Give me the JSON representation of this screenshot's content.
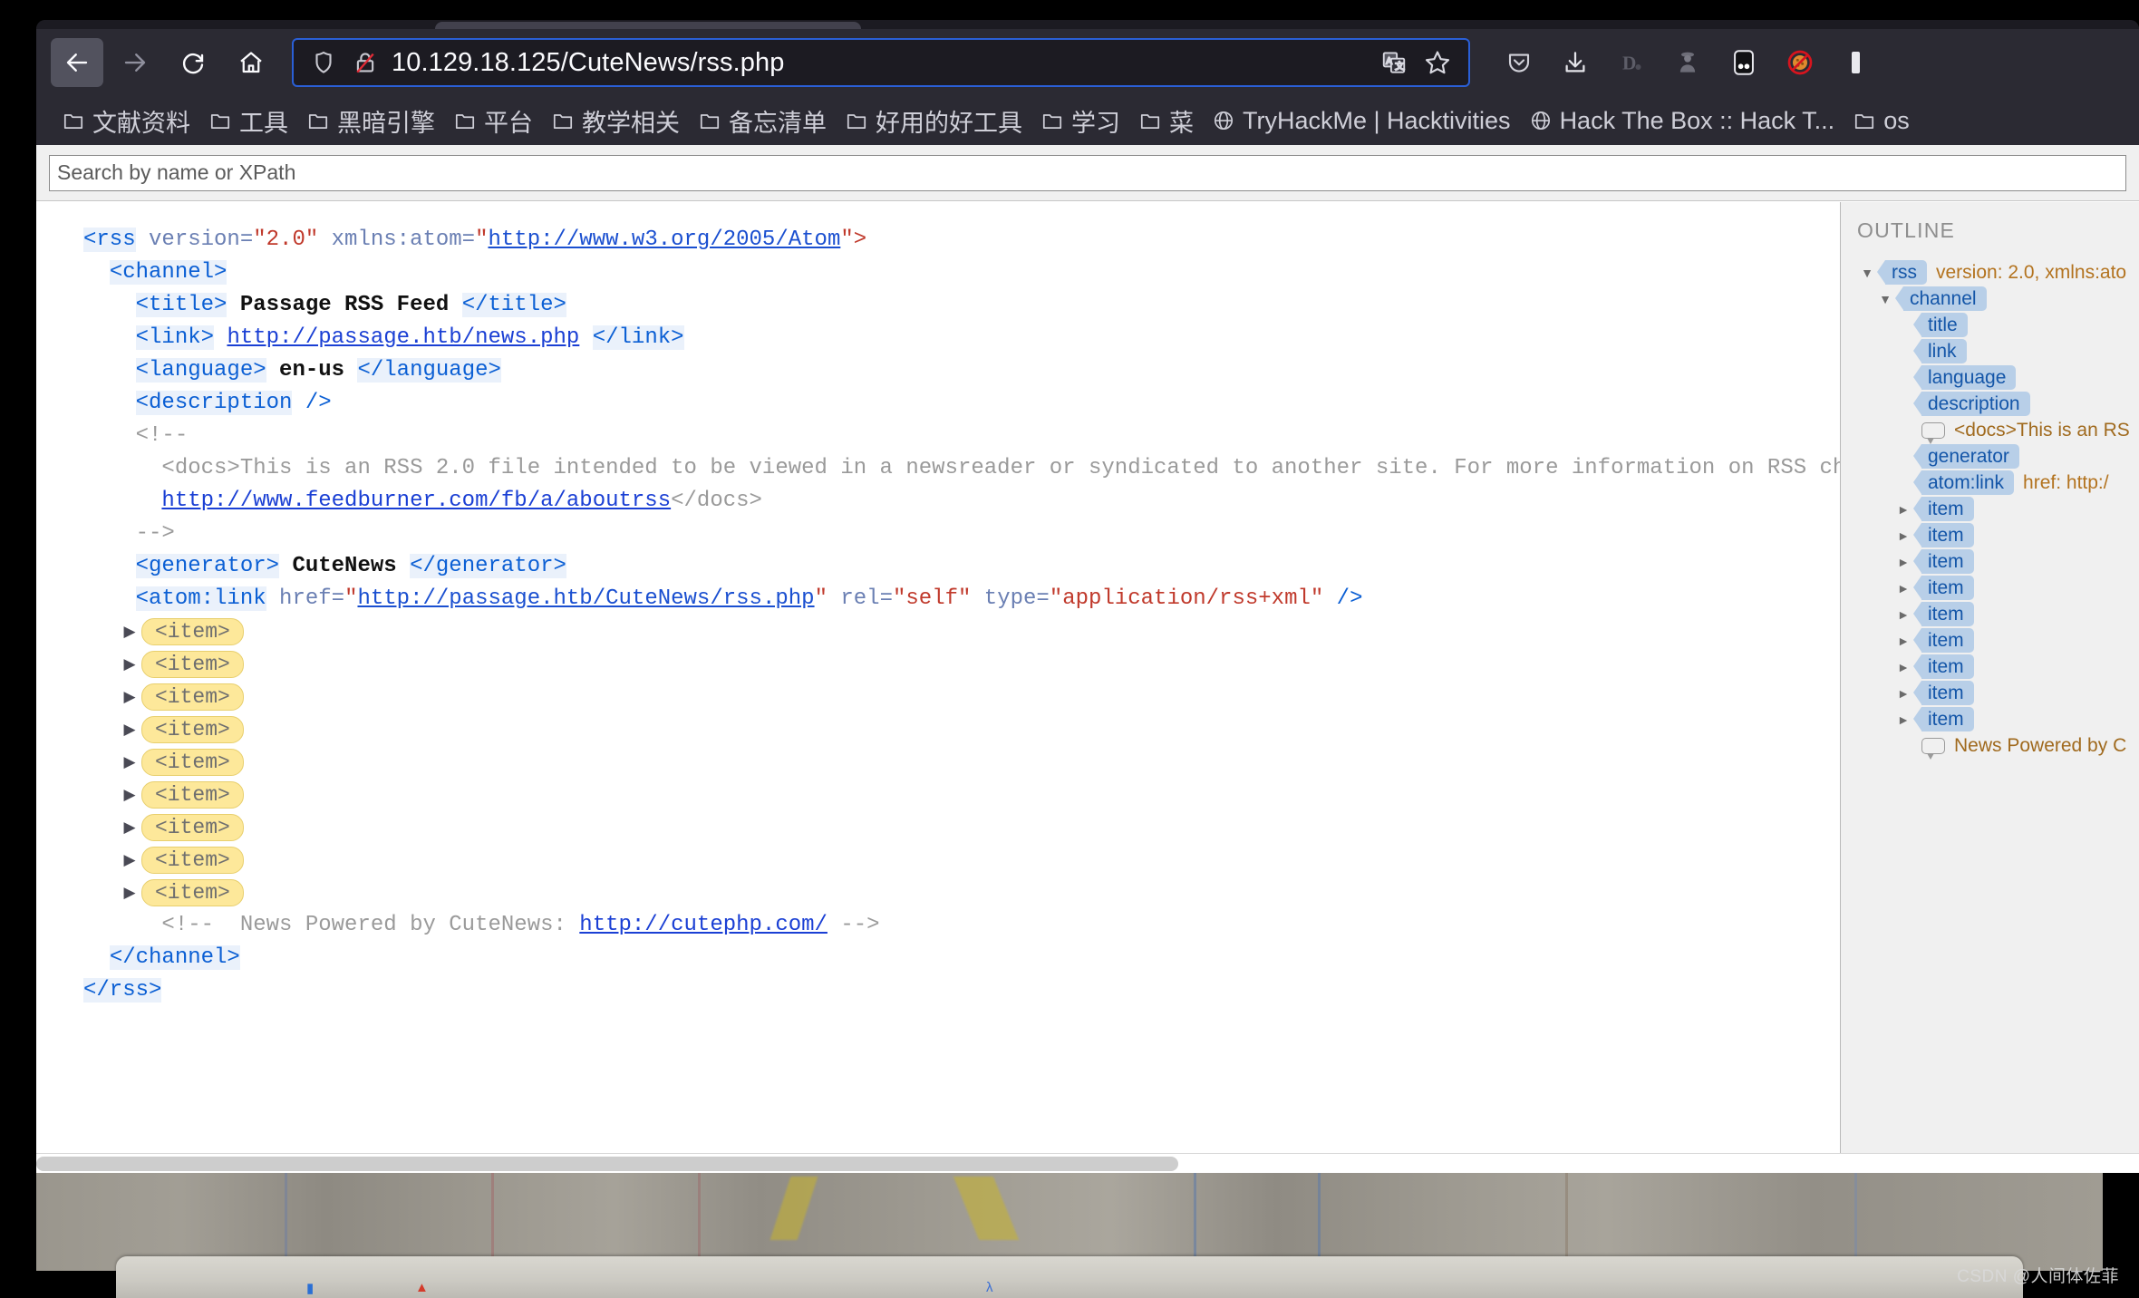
{
  "browser": {
    "nav": {
      "back_label": "Back",
      "forward_label": "Forward",
      "reload_label": "Reload",
      "home_label": "Home"
    },
    "urlbar": {
      "url": "10.129.18.125/CuteNews/rss.php",
      "shield_label": "Enhanced Tracking Protection",
      "lock_label": "Connection is not secure",
      "translate_label": "Translate this page",
      "bookmark_label": "Bookmark this page"
    },
    "toolbar_right": [
      {
        "name": "pocket-icon",
        "label": "Save to Pocket"
      },
      {
        "name": "download-icon",
        "label": "Downloads"
      },
      {
        "name": "darkreader-icon",
        "label": "Dark Reader"
      },
      {
        "name": "spy-icon",
        "label": "User-Agent Switcher"
      },
      {
        "name": "foxyproxy-icon",
        "label": "FoxyProxy"
      },
      {
        "name": "cookie-blocked-icon",
        "label": "Cookie Quick Manager"
      }
    ],
    "bookmarks": [
      {
        "icon": "folder-icon",
        "label": "文献资料"
      },
      {
        "icon": "folder-icon",
        "label": "工具"
      },
      {
        "icon": "folder-icon",
        "label": "黑暗引擎"
      },
      {
        "icon": "folder-icon",
        "label": "平台"
      },
      {
        "icon": "folder-icon",
        "label": "教学相关"
      },
      {
        "icon": "folder-icon",
        "label": "备忘清单"
      },
      {
        "icon": "folder-icon",
        "label": "好用的好工具"
      },
      {
        "icon": "folder-icon",
        "label": "学习"
      },
      {
        "icon": "folder-icon",
        "label": "菜"
      },
      {
        "icon": "globe-icon",
        "label": "TryHackMe | Hacktivities"
      },
      {
        "icon": "globe-icon",
        "label": "Hack The Box :: Hack T..."
      },
      {
        "icon": "folder-icon",
        "label": "os"
      }
    ]
  },
  "xml_viewer": {
    "search": {
      "placeholder": "Search by name or XPath",
      "value": ""
    },
    "lines": {
      "rss_open_tag": "<rss",
      "rss_attr_version": " version=",
      "rss_attr_version_val": "\"2.0\"",
      "rss_attr_ns": " xmlns:atom=",
      "rss_attr_ns_q1": "\"",
      "rss_attr_ns_val": "http://www.w3.org/2005/Atom",
      "rss_attr_ns_q2": "\">",
      "channel_open": "<channel>",
      "title_open": "<title>",
      "title_text": " Passage RSS Feed ",
      "title_close": "</title>",
      "link_open": "<link>",
      "link_text": "http://passage.htb/news.php",
      "link_close": "</link>",
      "language_open": "<language>",
      "language_text": " en-us ",
      "language_close": "</language>",
      "description_tag": "<description",
      "description_selfclose": " />",
      "comment_open": "<!--",
      "comment_docs_line": "<docs>This is an RSS 2.0 file intended to be viewed in a newsreader or syndicated to another site. For more information on RSS check:",
      "comment_docs_url": "http://www.feedburner.com/fb/a/aboutrss",
      "comment_docs_tail": "</docs>",
      "comment_close": "-->",
      "generator_open": "<generator>",
      "generator_text": " CuteNews ",
      "generator_close": "</generator>",
      "atomlink_tag": "<atom:link",
      "atomlink_attr_href": " href=",
      "atomlink_href_q1": "\"",
      "atomlink_href_val": "http://passage.htb/CuteNews/rss.php",
      "atomlink_href_q2": "\"",
      "atomlink_attr_rel": " rel=",
      "atomlink_rel_val": "\"self\"",
      "atomlink_attr_type": " type=",
      "atomlink_type_val": "\"application/rss+xml\"",
      "atomlink_selfclose": " />",
      "item_pill": "<item>",
      "item_count": 9,
      "footer_comment_open": "<!--  News Powered by CuteNews: ",
      "footer_comment_url": "http://cutephp.com/",
      "footer_comment_close": " -->",
      "channel_close": "</channel>",
      "rss_close": "</rss>"
    },
    "outline": {
      "title": "OUTLINE",
      "nodes": [
        {
          "depth": 0,
          "twisty": "▼",
          "tag": "rss",
          "attrs": "version: 2.0, xmlns:ato",
          "type": "element"
        },
        {
          "depth": 1,
          "twisty": "▼",
          "tag": "channel",
          "attrs": "",
          "type": "element"
        },
        {
          "depth": 2,
          "twisty": "",
          "tag": "title",
          "attrs": "",
          "type": "element"
        },
        {
          "depth": 2,
          "twisty": "",
          "tag": "link",
          "attrs": "",
          "type": "element"
        },
        {
          "depth": 2,
          "twisty": "",
          "tag": "language",
          "attrs": "",
          "type": "element"
        },
        {
          "depth": 2,
          "twisty": "",
          "tag": "description",
          "attrs": "",
          "type": "element"
        },
        {
          "depth": 2,
          "twisty": "",
          "tag": "",
          "attrs": "<docs>This is an RS",
          "type": "comment"
        },
        {
          "depth": 2,
          "twisty": "",
          "tag": "generator",
          "attrs": "",
          "type": "element"
        },
        {
          "depth": 2,
          "twisty": "",
          "tag": "atom:link",
          "attrs": "href: http:/",
          "type": "element"
        },
        {
          "depth": 2,
          "twisty": "►",
          "tag": "item",
          "attrs": "",
          "type": "element"
        },
        {
          "depth": 2,
          "twisty": "►",
          "tag": "item",
          "attrs": "",
          "type": "element"
        },
        {
          "depth": 2,
          "twisty": "►",
          "tag": "item",
          "attrs": "",
          "type": "element"
        },
        {
          "depth": 2,
          "twisty": "►",
          "tag": "item",
          "attrs": "",
          "type": "element"
        },
        {
          "depth": 2,
          "twisty": "►",
          "tag": "item",
          "attrs": "",
          "type": "element"
        },
        {
          "depth": 2,
          "twisty": "►",
          "tag": "item",
          "attrs": "",
          "type": "element"
        },
        {
          "depth": 2,
          "twisty": "►",
          "tag": "item",
          "attrs": "",
          "type": "element"
        },
        {
          "depth": 2,
          "twisty": "►",
          "tag": "item",
          "attrs": "",
          "type": "element"
        },
        {
          "depth": 2,
          "twisty": "►",
          "tag": "item",
          "attrs": "",
          "type": "element"
        },
        {
          "depth": 2,
          "twisty": "",
          "tag": "",
          "attrs": "News Powered by C",
          "type": "comment"
        }
      ]
    }
  },
  "desktop": {
    "watermark": "CSDN @人间体佐菲"
  },
  "colors": {
    "chrome_bg": "#2b2a33",
    "url_focus_border": "#2a5fd6",
    "tag_blue": "#0b5fd4",
    "attr_value_red": "#c0392b",
    "item_pill_yellow": "#fde89a",
    "outline_pill_blue": "#b8cfe8"
  }
}
